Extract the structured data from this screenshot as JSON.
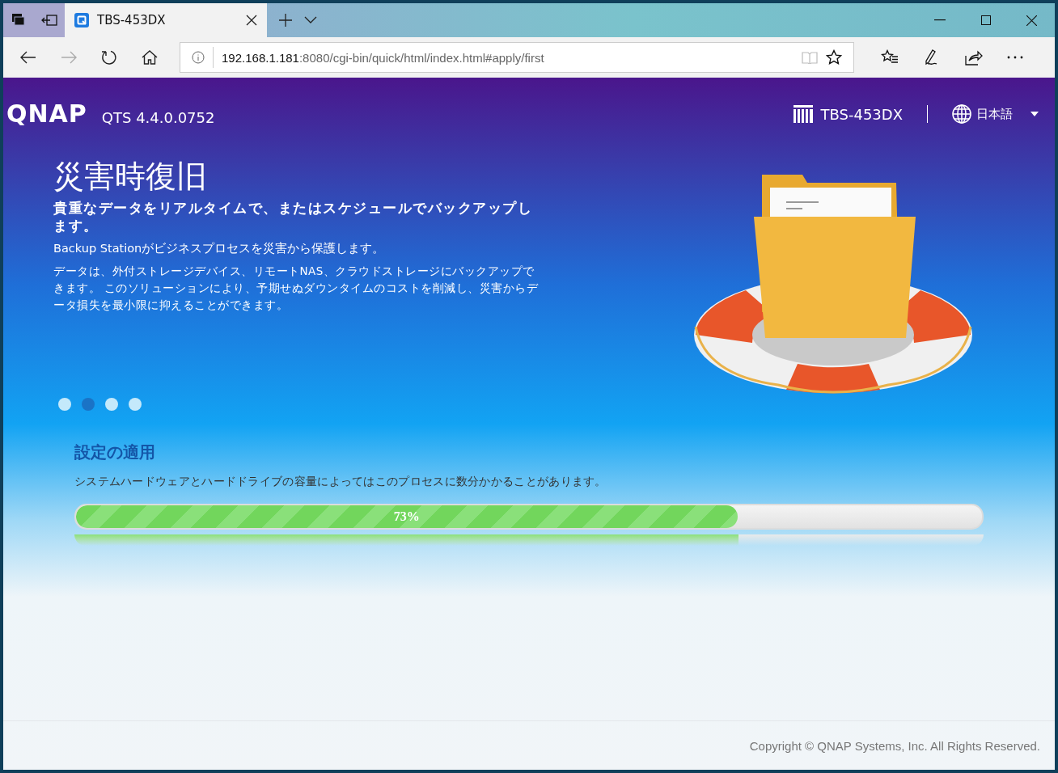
{
  "browser": {
    "tab": {
      "title": "TBS-453DX",
      "selected": true
    },
    "address": {
      "host": "192.168.1.181",
      "path": ":8080/cgi-bin/quick/html/index.html#apply/first"
    }
  },
  "header": {
    "logo": "QNAP",
    "version": "QTS 4.4.0.0752",
    "device": "TBS-453DX",
    "language": "日本語"
  },
  "slide": {
    "title": "災害時復旧",
    "subtitle": "貴重なデータをリアルタイムで、またはスケジュールでバックアップします。",
    "lead": "Backup Stationがビジネスプロセスを災害から保護します。",
    "body": "データは、外付ストレージデバイス、リモートNAS、クラウドストレージにバックアップできます。 このソリューションにより、予期せぬダウンタイムのコストを削減し、災害からデータ損失を最小限に抑えることができます。"
  },
  "dots": [
    {
      "selected": false
    },
    {
      "selected": true
    },
    {
      "selected": false
    },
    {
      "selected": false
    }
  ],
  "progress": {
    "title": "設定の適用",
    "note": "システムハードウェアとハードドライブの容量によってはこのプロセスに数分かかることがあります。",
    "level": 0.73,
    "reading": "73%"
  },
  "footer": "Copyright © QNAP Systems, Inc. All Rights Reserved."
}
